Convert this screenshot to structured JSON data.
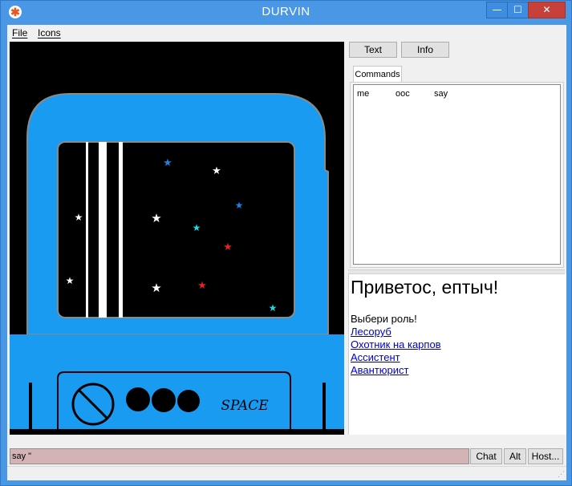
{
  "window": {
    "title": "DURVIN",
    "controls": {
      "minimize": "—",
      "maximize": "☐",
      "close": "✕"
    }
  },
  "menu": {
    "file": "File",
    "icons": "Icons"
  },
  "viewport": {
    "space_label": "SPACE",
    "colors": {
      "frame": "#1a9bf2",
      "screen": "#000000",
      "star_white": "#ffffff",
      "star_blue": "#1f7fe6",
      "star_cyan": "#21d9e6",
      "star_red": "#e61f1f"
    }
  },
  "panel": {
    "text_button": "Text",
    "info_button": "Info",
    "tab_commands": "Commands",
    "commands": [
      "me",
      "ooc",
      "say"
    ]
  },
  "info": {
    "heading": "Приветос, ептыч!",
    "prompt": "Выбери роль!",
    "roles": [
      "Лесоруб",
      "Охотник на карпов",
      "Ассистент",
      "Авантюрист"
    ]
  },
  "input": {
    "value": "say \""
  },
  "buttons": {
    "chat": "Chat",
    "alt": "Alt",
    "host": "Host..."
  }
}
